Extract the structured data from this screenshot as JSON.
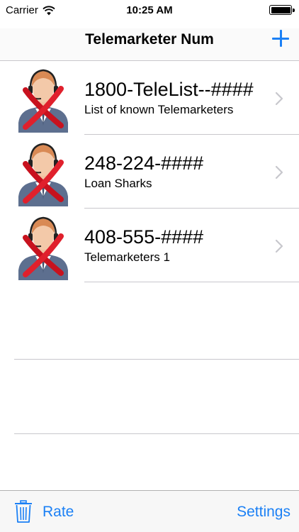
{
  "status_bar": {
    "carrier": "Carrier",
    "time": "10:25 AM",
    "battery_level_percent": 100
  },
  "nav_bar": {
    "title": "Telemarketer Num",
    "add_icon": "plus-icon",
    "accent_color": "#1b80f5"
  },
  "list": {
    "items": [
      {
        "title": "1800-TeleList--####",
        "subtitle": "List of known Telemarketers",
        "icon": "telemarketer-blocked-icon"
      },
      {
        "title": "248-224-####",
        "subtitle": "Loan Sharks",
        "icon": "telemarketer-blocked-icon"
      },
      {
        "title": "408-555-####",
        "subtitle": "Telemarketers 1",
        "icon": "telemarketer-blocked-icon"
      }
    ]
  },
  "toolbar": {
    "trash_icon": "trash-icon",
    "rate_label": "Rate",
    "settings_label": "Settings"
  }
}
